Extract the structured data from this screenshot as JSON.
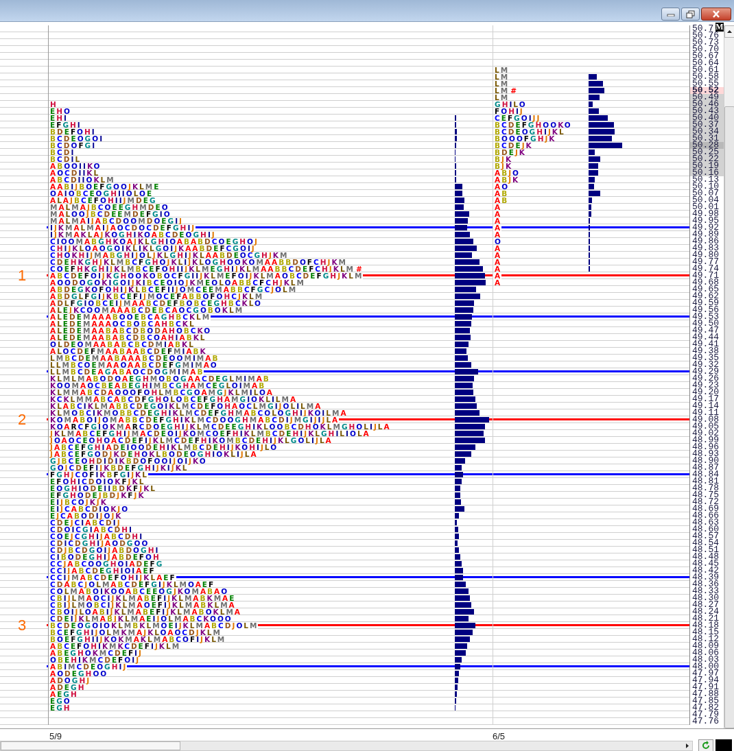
{
  "letter_colors": [
    {
      "color": "#ff0000"
    },
    {
      "color": "#b0a800"
    },
    {
      "color": "#0000ff"
    },
    {
      "color": "#9a5a20"
    },
    {
      "color": "#008000"
    },
    {
      "color": "#000000"
    },
    {
      "color": "#008b8b"
    },
    {
      "color": "#d01040"
    },
    {
      "color": "#000090"
    },
    {
      "color": "#e07800"
    },
    {
      "color": "#800080"
    },
    {
      "color": "#7a5800"
    },
    {
      "color": "#707070"
    },
    {
      "color": "#0000cc"
    }
  ],
  "axis_badge": "M",
  "rows": [
    {
      "price": "50.7",
      "last": false,
      "value_area": false,
      "poc": false
    },
    {
      "price": "50.76",
      "last": false,
      "value_area": false,
      "poc": false
    },
    {
      "price": "50.73",
      "last": false,
      "value_area": false,
      "poc": false
    },
    {
      "price": "50.70",
      "last": false,
      "value_area": false,
      "poc": false
    },
    {
      "price": "50.67",
      "last": false,
      "value_area": false,
      "poc": false
    },
    {
      "price": "50.64",
      "last": false,
      "value_area": false,
      "poc": false
    },
    {
      "price": "50.61",
      "last": false,
      "value_area": false,
      "poc": false,
      "right": "LM"
    },
    {
      "price": "50.58",
      "last": false,
      "value_area": false,
      "poc": false,
      "right": "LM"
    },
    {
      "price": "50.55",
      "last": false,
      "value_area": false,
      "poc": false,
      "right": "LM"
    },
    {
      "price": "50.52",
      "last": true,
      "value_area": false,
      "poc": false,
      "right": "LM",
      "flag": "#"
    },
    {
      "price": "50.49",
      "last": false,
      "value_area": true,
      "poc": false,
      "right": "LM"
    },
    {
      "price": "50.46",
      "last": false,
      "value_area": true,
      "poc": false,
      "left": "H",
      "right": "GHILO"
    },
    {
      "price": "50.43",
      "last": false,
      "value_area": true,
      "poc": false,
      "left": "EHO",
      "right": "FOHIJ"
    },
    {
      "price": "50.40",
      "last": false,
      "value_area": true,
      "poc": false,
      "left": "EHI",
      "right": "CEFGOIJJ"
    },
    {
      "price": "50.37",
      "last": false,
      "value_area": true,
      "poc": false,
      "left": "EFGHI",
      "right": "BCDEFGHOOKO"
    },
    {
      "price": "50.34",
      "last": false,
      "value_area": true,
      "poc": false,
      "left": "BDEFOHI",
      "right": "BCDEOGHIJKL"
    },
    {
      "price": "50.31",
      "last": false,
      "value_area": true,
      "poc": false,
      "left": "BCDEOGOI",
      "right": "BOOOFGHJK"
    },
    {
      "price": "50.28",
      "last": false,
      "value_area": true,
      "poc": true,
      "left": "BCDOFGI",
      "right": "BCDEJK"
    },
    {
      "price": "50.25",
      "last": false,
      "value_area": true,
      "poc": false,
      "left": "BCDI",
      "right": "BDEJK"
    },
    {
      "price": "50.22",
      "last": false,
      "value_area": true,
      "poc": false,
      "left": "BCDIL",
      "right": "BJK"
    },
    {
      "price": "50.19",
      "last": false,
      "value_area": true,
      "poc": false,
      "left": "ABOOIIKO",
      "right": "BJK"
    },
    {
      "price": "50.16",
      "last": false,
      "value_area": true,
      "poc": false,
      "left": "AOCDIIKL",
      "right": "ABJO"
    },
    {
      "price": "50.13",
      "last": false,
      "value_area": false,
      "poc": false,
      "left": "ABCDIIOKLM",
      "right": "ABJK"
    },
    {
      "price": "50.10",
      "last": false,
      "value_area": false,
      "poc": false,
      "left": "AABIJBOEFGOOJKLME",
      "right": "AO"
    },
    {
      "price": "50.07",
      "last": false,
      "value_area": false,
      "poc": false,
      "left": "OAIOBCEOGHIIOLOE",
      "right": "AB"
    },
    {
      "price": "50.04",
      "last": false,
      "value_area": false,
      "poc": false,
      "left": "ALAJBCEFOHIIJMDEG",
      "right": "AB"
    },
    {
      "price": "50.01",
      "last": false,
      "value_area": false,
      "poc": false,
      "left": "MALMAJBCOEEGHMDEO",
      "right": "A"
    },
    {
      "price": "49.98",
      "last": false,
      "value_area": false,
      "poc": false,
      "left": "MALOOJBCDEEMDEFGIO",
      "right": "A"
    },
    {
      "price": "49.95",
      "last": false,
      "value_area": false,
      "poc": false,
      "left": "MALMAIJABCDOOMDOEGIJ",
      "right": "A"
    },
    {
      "price": "49.92",
      "last": false,
      "value_area": false,
      "poc": false,
      "left": "IJKMALMAIJAOCDOCDEFGHIJ",
      "right": "A",
      "line": {
        "kind": "value_area"
      }
    },
    {
      "price": "49.89",
      "last": false,
      "value_area": false,
      "poc": false,
      "left": "IJKMAKLAJKOGHIKOABCDEOGHIJ",
      "right": "A"
    },
    {
      "price": "49.86",
      "last": false,
      "value_area": false,
      "poc": false,
      "left": "CIOOMABGHKOAJKLGHIOABABDCOEGHOJ",
      "right": "O"
    },
    {
      "price": "49.83",
      "last": false,
      "value_area": false,
      "poc": false,
      "left": "CHIJKLOAOGOIKLIKLGOIJKAABDEFCGOIJ",
      "right": "A"
    },
    {
      "price": "49.80",
      "last": false,
      "value_area": false,
      "poc": false,
      "left": "CHOKHIJMABGHIJOLJKLGHIJKLAABDEOCGHJKM",
      "right": "A"
    },
    {
      "price": "49.77",
      "last": false,
      "value_area": false,
      "poc": false,
      "left": "CDEHKGHJKLMBCFGHOJKLIJKLOGHOOKOMAABBDOFCHJKM",
      "right": "A"
    },
    {
      "price": "49.74",
      "last": false,
      "value_area": false,
      "poc": false,
      "left": "COEFHKGHIJKLMBCEFOHIIJKLMEGHIJKLMAABBCDEFCHJKLM",
      "left_flag": "#",
      "right": "A"
    },
    {
      "price": "49.71",
      "last": false,
      "value_area": false,
      "poc": false,
      "left": "ABCDEFOIJKGHOOKOBOCFGIIJKLMEFOIJKLMAOBCDEFGHJKLM",
      "right": "A",
      "line": {
        "kind": "poc"
      },
      "marker": "1"
    },
    {
      "price": "49.68",
      "last": false,
      "value_area": false,
      "poc": false,
      "left": "AOODOGOKIGOIJKIBCEOIOJKMEOLOABBCFCHJKLM",
      "right": "A"
    },
    {
      "price": "49.65",
      "last": false,
      "value_area": false,
      "poc": false,
      "left": "ABDEGKOFOHIJKLBCEFIIJOMCEEMABBCFGCJOLM"
    },
    {
      "price": "49.62",
      "last": false,
      "value_area": false,
      "poc": false,
      "left": "ABDGLFGIJKBCEFIJMOCEFABBOFOHCJKLM"
    },
    {
      "price": "49.59",
      "last": false,
      "value_area": false,
      "poc": false,
      "left": "ADLFGIOBCEIJMAABCDEFBOBCEGHBCKLO"
    },
    {
      "price": "49.56",
      "last": false,
      "value_area": false,
      "poc": false,
      "left": "ALEJKCOOMAAABCDEBCAOCGOBOKLM"
    },
    {
      "price": "49.53",
      "last": false,
      "value_area": false,
      "poc": false,
      "left": "ALEDEMAAABOOEBCAGHBCKLM",
      "line": {
        "kind": "value_area"
      }
    },
    {
      "price": "49.50",
      "last": false,
      "value_area": false,
      "poc": false,
      "left": "ALEDEMAAAOCBOBCAHBCKL"
    },
    {
      "price": "49.47",
      "last": false,
      "value_area": false,
      "poc": false,
      "left": "ALEDEMAABABCDBODAHOBCKO"
    },
    {
      "price": "49.44",
      "last": false,
      "value_area": false,
      "poc": false,
      "left": "ALEDEMAABABCDBCOAHIABKL"
    },
    {
      "price": "49.41",
      "last": false,
      "value_area": false,
      "poc": false,
      "left": "OLDEOMAABABCBCDMIABKL"
    },
    {
      "price": "49.38",
      "last": false,
      "value_area": false,
      "poc": false,
      "left": "ALOCDEFMAABAABCDEFMIABK"
    },
    {
      "price": "49.35",
      "last": false,
      "value_area": false,
      "poc": false,
      "left": "LMBCDEMAABAAABCDEOOMIMAB"
    },
    {
      "price": "49.32",
      "last": false,
      "value_area": false,
      "poc": false,
      "left": "LLMBCOEMAAOAABCDEFGMIMAO"
    },
    {
      "price": "49.29",
      "last": false,
      "value_area": false,
      "poc": false,
      "left": "LLMBCDEAGABAOCDOGMIMAB",
      "line": {
        "kind": "value_area"
      }
    },
    {
      "price": "49.26",
      "last": false,
      "value_area": false,
      "poc": false,
      "left": "KLMLMABODOAEGHMOBOGAACDEGLMIMAB"
    },
    {
      "price": "49.23",
      "last": false,
      "value_area": false,
      "poc": false,
      "left": "KOOMAOCBEABEGHIMBCGHAMCEGLOIMAB"
    },
    {
      "price": "49.20",
      "last": false,
      "value_area": false,
      "poc": false,
      "left": "KLMMABCDAOOOFOHLMBCGOAMGJKLMILOA"
    },
    {
      "price": "49.17",
      "last": false,
      "value_area": false,
      "poc": false,
      "left": "KCKLMMABCABCDFGHOLOBCEFGHAMGIOKLILMA"
    },
    {
      "price": "49.14",
      "last": false,
      "value_area": false,
      "poc": false,
      "left": "KLABCIKLMABBCDEGOIKLMCDEFOHAOCLMGIJOLILMA"
    },
    {
      "price": "49.11",
      "last": false,
      "value_area": false,
      "poc": false,
      "left": "KLMOBCIKMOBBCDEGHIKLMCDEFGHMABCOLOGHIJKOILMA"
    },
    {
      "price": "49.08",
      "last": false,
      "value_area": false,
      "poc": false,
      "left": "KOMABOIJOMABBCDEFGHIKLMCDOOGHMABCDIJMGIJIJLA",
      "line": {
        "kind": "poc"
      },
      "marker": "2"
    },
    {
      "price": "49.05",
      "last": false,
      "value_area": false,
      "poc": false,
      "left": "KOARCFGIOKMARCDOEGHIJKLMCDEEGHIKLOOBCDHOKLMGHOLIJLA"
    },
    {
      "price": "49.02",
      "last": false,
      "value_area": false,
      "poc": false,
      "left": "JKLMABCEFGHIJMACDEOIJKOMCOEFHIKLMBCDEHIJKLGHILIOLA"
    },
    {
      "price": "48.99",
      "last": false,
      "value_area": false,
      "poc": false,
      "left": "JOAOCEOHOACDEFIJKLMCDEFHIKOMBCDEHIJKLGOLIJLA"
    },
    {
      "price": "48.96",
      "last": false,
      "value_area": false,
      "poc": false,
      "left": "JABCEFGHIADEIOODEHIKLMBCDEHIJKOHIJLO"
    },
    {
      "price": "48.93",
      "last": false,
      "value_area": false,
      "poc": false,
      "left": "JABCEFGODJKDEHOKLBODEOGHIOKLIJLA"
    },
    {
      "price": "48.90",
      "last": false,
      "value_area": false,
      "poc": false,
      "left": "GJBCEOHDIDIKBDOFOOIJOIJKO"
    },
    {
      "price": "48.87",
      "last": false,
      "value_area": false,
      "poc": false,
      "left": "GOJCDEFIJKBDEFGHIJKIJKL"
    },
    {
      "price": "48.84",
      "last": false,
      "value_area": false,
      "poc": false,
      "left": "FGHJCOFIKBFGIJKL",
      "line": {
        "kind": "value_area"
      }
    },
    {
      "price": "48.81",
      "last": false,
      "value_area": false,
      "poc": false,
      "left": "EFOHICDOIOKFJKL"
    },
    {
      "price": "48.78",
      "last": false,
      "value_area": false,
      "poc": false,
      "left": "EOGHIODEIIBDKFJKL"
    },
    {
      "price": "48.75",
      "last": false,
      "value_area": false,
      "poc": false,
      "left": "EFGHODEJBDJKFJK"
    },
    {
      "price": "48.72",
      "last": false,
      "value_area": false,
      "poc": false,
      "left": "EIJBCOJKJK"
    },
    {
      "price": "48.69",
      "last": false,
      "value_area": false,
      "poc": false,
      "left": "EIJCABCDIOKJO"
    },
    {
      "price": "48.66",
      "last": false,
      "value_area": false,
      "poc": false,
      "left": "EJCABODIJOJK"
    },
    {
      "price": "48.63",
      "last": false,
      "value_area": false,
      "poc": false,
      "left": "CDEJCIABCDIJ"
    },
    {
      "price": "48.60",
      "last": false,
      "value_area": false,
      "poc": false,
      "left": "CDOICGIABCDHI"
    },
    {
      "price": "48.57",
      "last": false,
      "value_area": false,
      "poc": false,
      "left": "COEJCGHIJABCDHI"
    },
    {
      "price": "48.54",
      "last": false,
      "value_area": false,
      "poc": false,
      "left": "CDICDGHIJAODGOO"
    },
    {
      "price": "48.51",
      "last": false,
      "value_area": false,
      "poc": false,
      "left": "CDJBCDGOIJABDOGHI"
    },
    {
      "price": "48.48",
      "last": false,
      "value_area": false,
      "poc": false,
      "left": "CIBODEGHIJABDEFOH"
    },
    {
      "price": "48.45",
      "last": false,
      "value_area": false,
      "poc": false,
      "left": "CCJABCOOGHOIADEFG"
    },
    {
      "price": "48.42",
      "last": false,
      "value_area": false,
      "poc": false,
      "left": "CCIJABCDEGHIOIAEF"
    },
    {
      "price": "48.39",
      "last": false,
      "value_area": false,
      "poc": false,
      "left": "CCIJMABCDEFOHIJKLAEF",
      "line": {
        "kind": "value_area"
      }
    },
    {
      "price": "48.36",
      "last": false,
      "value_area": false,
      "poc": false,
      "left": "CDABCJOLMABCDEFGIJKLMOAEF"
    },
    {
      "price": "48.33",
      "last": false,
      "value_area": false,
      "poc": false,
      "left": "COLMABOIKOOABCEEOGJKOMABAO"
    },
    {
      "price": "48.30",
      "last": false,
      "value_area": false,
      "poc": false,
      "left": "CBIJLMAOCIJKLMABEFIJKLMABKMAE"
    },
    {
      "price": "48.27",
      "last": false,
      "value_area": false,
      "poc": false,
      "left": "CBIJLMOBCIJKLMAOEFIJKLMABKLMA"
    },
    {
      "price": "48.24",
      "last": false,
      "value_area": false,
      "poc": false,
      "left": "CBOIJLOABIJKLMABEFIJKLMABOKLMA"
    },
    {
      "price": "48.21",
      "last": false,
      "value_area": false,
      "poc": false,
      "left": "CDEIJKLMABJKLMAEIJOLMABCKOOO"
    },
    {
      "price": "48.18",
      "last": false,
      "value_area": false,
      "poc": false,
      "left": "BCDEOGOIOKLMBKLMOEIJKLMABCDJOLM",
      "line": {
        "kind": "poc"
      },
      "marker": "3"
    },
    {
      "price": "48.15",
      "last": false,
      "value_area": false,
      "poc": false,
      "left": "BCEFGHIJOLMKMAJKLOAOCDJKLM"
    },
    {
      "price": "48.12",
      "last": false,
      "value_area": false,
      "poc": false,
      "left": "BOEFGHIIJKOKMAKLMABCOFIJKLM"
    },
    {
      "price": "48.09",
      "last": false,
      "value_area": false,
      "poc": false,
      "left": "ABCEFOHIKMKCDEFIJKLM"
    },
    {
      "price": "48.06",
      "last": false,
      "value_area": false,
      "poc": false,
      "left": "ABEGHOKMCDEFIJ"
    },
    {
      "price": "48.03",
      "last": false,
      "value_area": false,
      "poc": false,
      "left": "OBEHIKMCDEFOIJ"
    },
    {
      "price": "48.00",
      "last": false,
      "value_area": false,
      "poc": false,
      "left": "ABIMCDEOGHIJ",
      "line": {
        "kind": "value_area"
      }
    },
    {
      "price": "47.97",
      "last": false,
      "value_area": false,
      "poc": false,
      "left": "AODEGHOO"
    },
    {
      "price": "47.94",
      "last": false,
      "value_area": false,
      "poc": false,
      "left": "ADOGHJ"
    },
    {
      "price": "47.91",
      "last": false,
      "value_area": false,
      "poc": false,
      "left": "ADEGH"
    },
    {
      "price": "47.88",
      "last": false,
      "value_area": false,
      "poc": false,
      "left": "AEGH"
    },
    {
      "price": "47.85",
      "last": false,
      "value_area": false,
      "poc": false,
      "left": "EGO"
    },
    {
      "price": "47.82",
      "last": false,
      "value_area": false,
      "poc": false,
      "left": "EGH"
    },
    {
      "price": "47.79",
      "last": false,
      "value_area": false,
      "poc": false
    },
    {
      "price": "47.76",
      "last": false,
      "value_area": false,
      "poc": false
    }
  ],
  "sessions": [
    {
      "date": "5/9"
    },
    {
      "date": "6/5"
    }
  ]
}
